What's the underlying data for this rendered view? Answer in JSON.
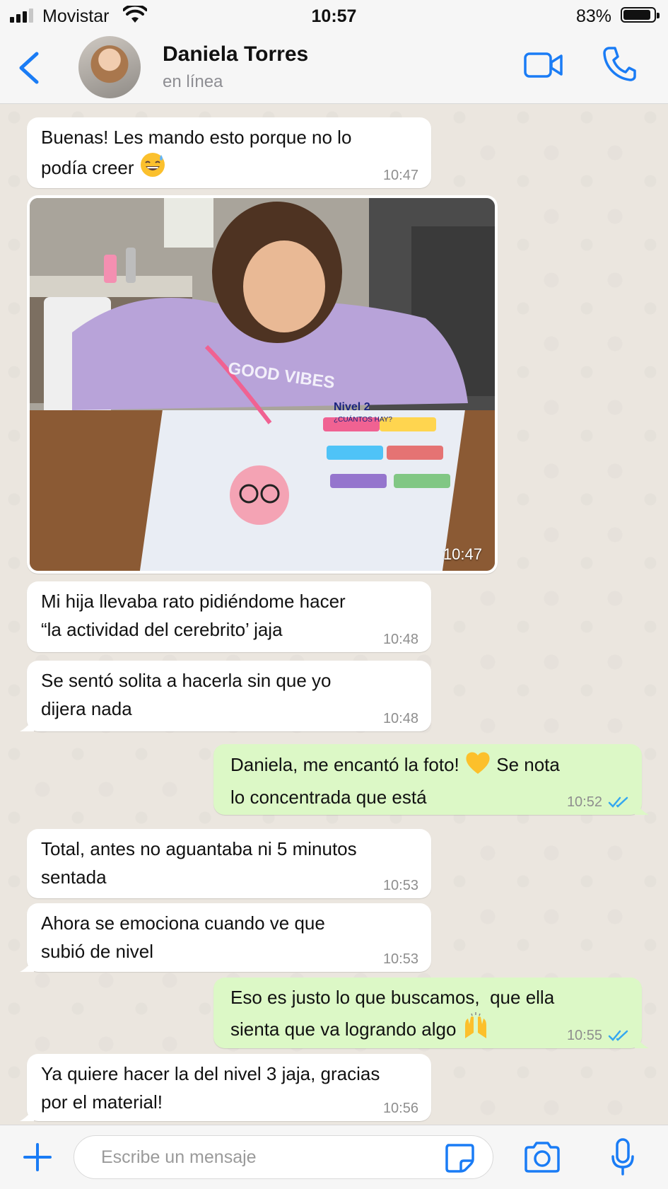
{
  "status_bar": {
    "carrier": "Movistar",
    "time": "10:57",
    "battery": "83%"
  },
  "header": {
    "contact_name": "Daniela Torres",
    "contact_status": "en línea"
  },
  "messages": [
    {
      "text_1": "Buenas! Les mando esto porque no lo",
      "text_2": "podía creer",
      "emoji": "😅",
      "time": "10:47"
    },
    {
      "photo_time": "10:47",
      "photo_caption_title": "Nivel 2",
      "photo_caption_sub": "¿CUÁNTOS HAY?",
      "shirt_text": "GOOD VIBES"
    },
    {
      "text_1": "Mi hija llevaba rato pidiéndome hacer",
      "text_2": "“la actividad del cerebrito’ jaja",
      "time": "10:48"
    },
    {
      "text_1": "Se sentó solita a hacerla sin que yo",
      "text_2": "dijera nada",
      "time": "10:48"
    },
    {
      "text_1": "Daniela, me encantó la foto!",
      "emoji": "💛",
      "text_1b": "Se nota",
      "text_2": "lo concentrada que está",
      "time": "10:52",
      "status": "read"
    },
    {
      "text_1": "Total, antes no aguantaba ni 5 minutos",
      "text_2": "sentada",
      "time": "10:53"
    },
    {
      "text_1": "Ahora se emociona cuando ve que",
      "text_2": "subió de nivel",
      "time": "10:53"
    },
    {
      "text_1": "Eso es justo lo que buscamos,  que ella",
      "text_2": "sienta que va logrando algo",
      "emoji": "🙌",
      "time": "10:55",
      "status": "read"
    },
    {
      "text_1": "Ya quiere hacer la del nivel 3 jaja, gracias",
      "text_2": "por el material!",
      "time": "10:56"
    }
  ],
  "composer": {
    "placeholder": "Escribe un mensaje"
  },
  "colors": {
    "accent": "#1a7cf5",
    "outgoing_bubble": "#dcf8c6",
    "incoming_bubble": "#ffffff",
    "read_ticks": "#34a7f0"
  }
}
